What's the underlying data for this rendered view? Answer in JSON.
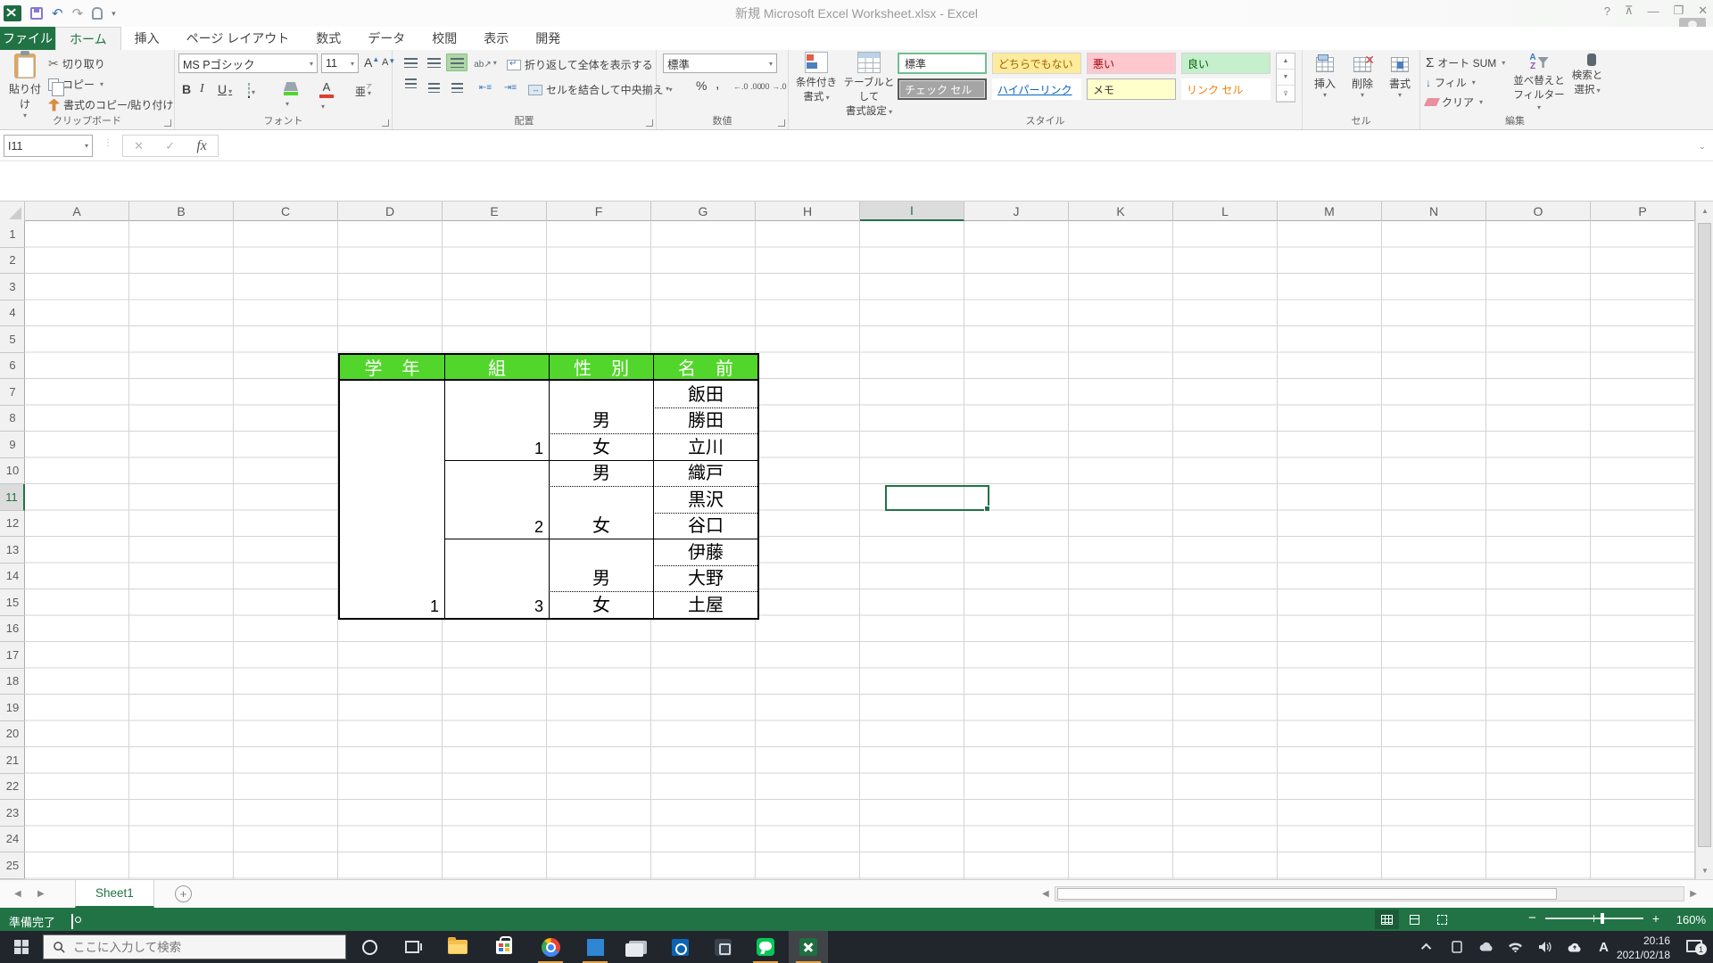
{
  "colors": {
    "excel_green": "#217346",
    "table_header_green": "#52d62b",
    "fill_swatch_green": "#52d62b",
    "font_color_swatch_red": "#e03c31",
    "style_neutral_bg": "#ffeb9c",
    "style_bad_bg": "#ffc7ce",
    "style_good_bg": "#c6efce",
    "style_check_bg": "#a5a5a5",
    "style_memo_bg": "#ffffcc",
    "hyperlink_blue": "#0563c1",
    "link_cell_orange": "#fa7d00",
    "taskbar_bg": "#21262c"
  },
  "window": {
    "title": "新規 Microsoft Excel Worksheet.xlsx - Excel"
  },
  "ribbon_tabs": {
    "file": "ファイル",
    "tabs": [
      "ホーム",
      "挿入",
      "ページ レイアウト",
      "数式",
      "データ",
      "校閲",
      "表示",
      "開発"
    ],
    "active": "ホーム"
  },
  "clipboard": {
    "label": "クリップボード",
    "paste": "貼り付け",
    "cut": "切り取り",
    "copy": "コピー",
    "format_painter": "書式のコピー/貼り付け"
  },
  "font_group": {
    "label": "フォント",
    "font_name": "MS Pゴシック",
    "font_size": "11",
    "bold": "B",
    "italic": "I",
    "underline": "U",
    "grow": "A",
    "shrink": "A",
    "font_color": "A",
    "phonetic": "亜"
  },
  "alignment_group": {
    "label": "配置",
    "wrap_text": "折り返して全体を表示する",
    "merge_center": "セルを結合して中央揃え"
  },
  "number_group": {
    "label": "数値",
    "format": "標準",
    "percent": "%",
    "comma": ",",
    "dec_increase": "←.0 .00",
    "dec_decrease": ".00 →.0"
  },
  "styles_group": {
    "label": "スタイル",
    "conditional_1": "条件付き",
    "conditional_2": "書式",
    "as_table_1": "テーブルとして",
    "as_table_2": "書式設定",
    "gallery": [
      "標準",
      "どちらでもない",
      "悪い",
      "良い",
      "チェック セル",
      "ハイパーリンク",
      "メモ",
      "リンク セル"
    ]
  },
  "cells_group": {
    "label": "セル",
    "insert": "挿入",
    "delete": "削除",
    "format": "書式"
  },
  "editing_group": {
    "label": "編集",
    "autosum": "オート SUM",
    "fill": "フィル",
    "clear": "クリア",
    "sort_1": "並べ替えと",
    "sort_2": "フィルター",
    "find_1": "検索と",
    "find_2": "選択"
  },
  "formula_bar": {
    "name_box": "I11",
    "fx": "fx",
    "formula": ""
  },
  "grid": {
    "columns": [
      "A",
      "B",
      "C",
      "D",
      "E",
      "F",
      "G",
      "H",
      "I",
      "J",
      "K",
      "L",
      "M",
      "N",
      "O",
      "P"
    ],
    "rows": [
      "1",
      "2",
      "3",
      "4",
      "5",
      "6",
      "7",
      "8",
      "9",
      "10",
      "11",
      "12",
      "13",
      "14",
      "15",
      "16",
      "17",
      "18",
      "19",
      "20",
      "21",
      "22",
      "23",
      "24",
      "25"
    ],
    "selected_cell": "I11",
    "selected_column": "I",
    "selected_row": "11"
  },
  "sheet_table": {
    "headers": [
      "学年",
      "組",
      "性別",
      "名前"
    ],
    "grade": "1",
    "groups": [
      {
        "no": "1",
        "male": "男",
        "female": "女",
        "names": [
          "飯田",
          "勝田",
          "立川"
        ]
      },
      {
        "no": "2",
        "male": "男",
        "female": "女",
        "names": [
          "織戸",
          "黒沢",
          "谷口"
        ]
      },
      {
        "no": "3",
        "male": "男",
        "female": "女",
        "names": [
          "伊藤",
          "大野",
          "土屋"
        ]
      }
    ]
  },
  "sheet_tabs": {
    "active": "Sheet1"
  },
  "status_bar": {
    "ready": "準備完了",
    "zoom_level": "160%"
  },
  "taskbar": {
    "search_placeholder": "ここに入力して検索",
    "ime": "A",
    "time": "20:16",
    "date": "2021/02/18",
    "notification_count": "1"
  }
}
